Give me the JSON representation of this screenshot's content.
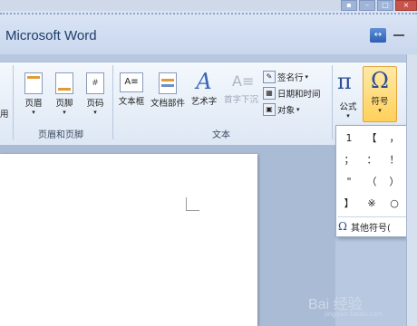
{
  "window": {
    "app_title": "Microsoft Word"
  },
  "ribbon": {
    "left_partial_label": "用",
    "header_footer_group": {
      "label": "页眉和页脚",
      "buttons": [
        "页眉",
        "页脚",
        "页码"
      ]
    },
    "text_group": {
      "label": "文本",
      "buttons": [
        "文本框",
        "文档部件",
        "艺术字",
        "首字下沉"
      ],
      "small_buttons": [
        "签名行",
        "日期和时间",
        "对象"
      ]
    },
    "symbols_group": {
      "buttons": [
        "公式",
        "符号"
      ]
    }
  },
  "symbol_dropdown": {
    "symbols": [
      "1",
      "【",
      "，",
      "；",
      "：",
      "！",
      "\"",
      "（",
      "）",
      "】",
      "※",
      "○"
    ],
    "more_label": "其他符号("
  },
  "watermark": {
    "text": "Bai 经验",
    "sub": "jingyan.baidu.com"
  },
  "colors": {
    "ribbon_bg": "#e8eff9",
    "selected_button": "#ffd05a",
    "accent": "#2c4f91"
  }
}
